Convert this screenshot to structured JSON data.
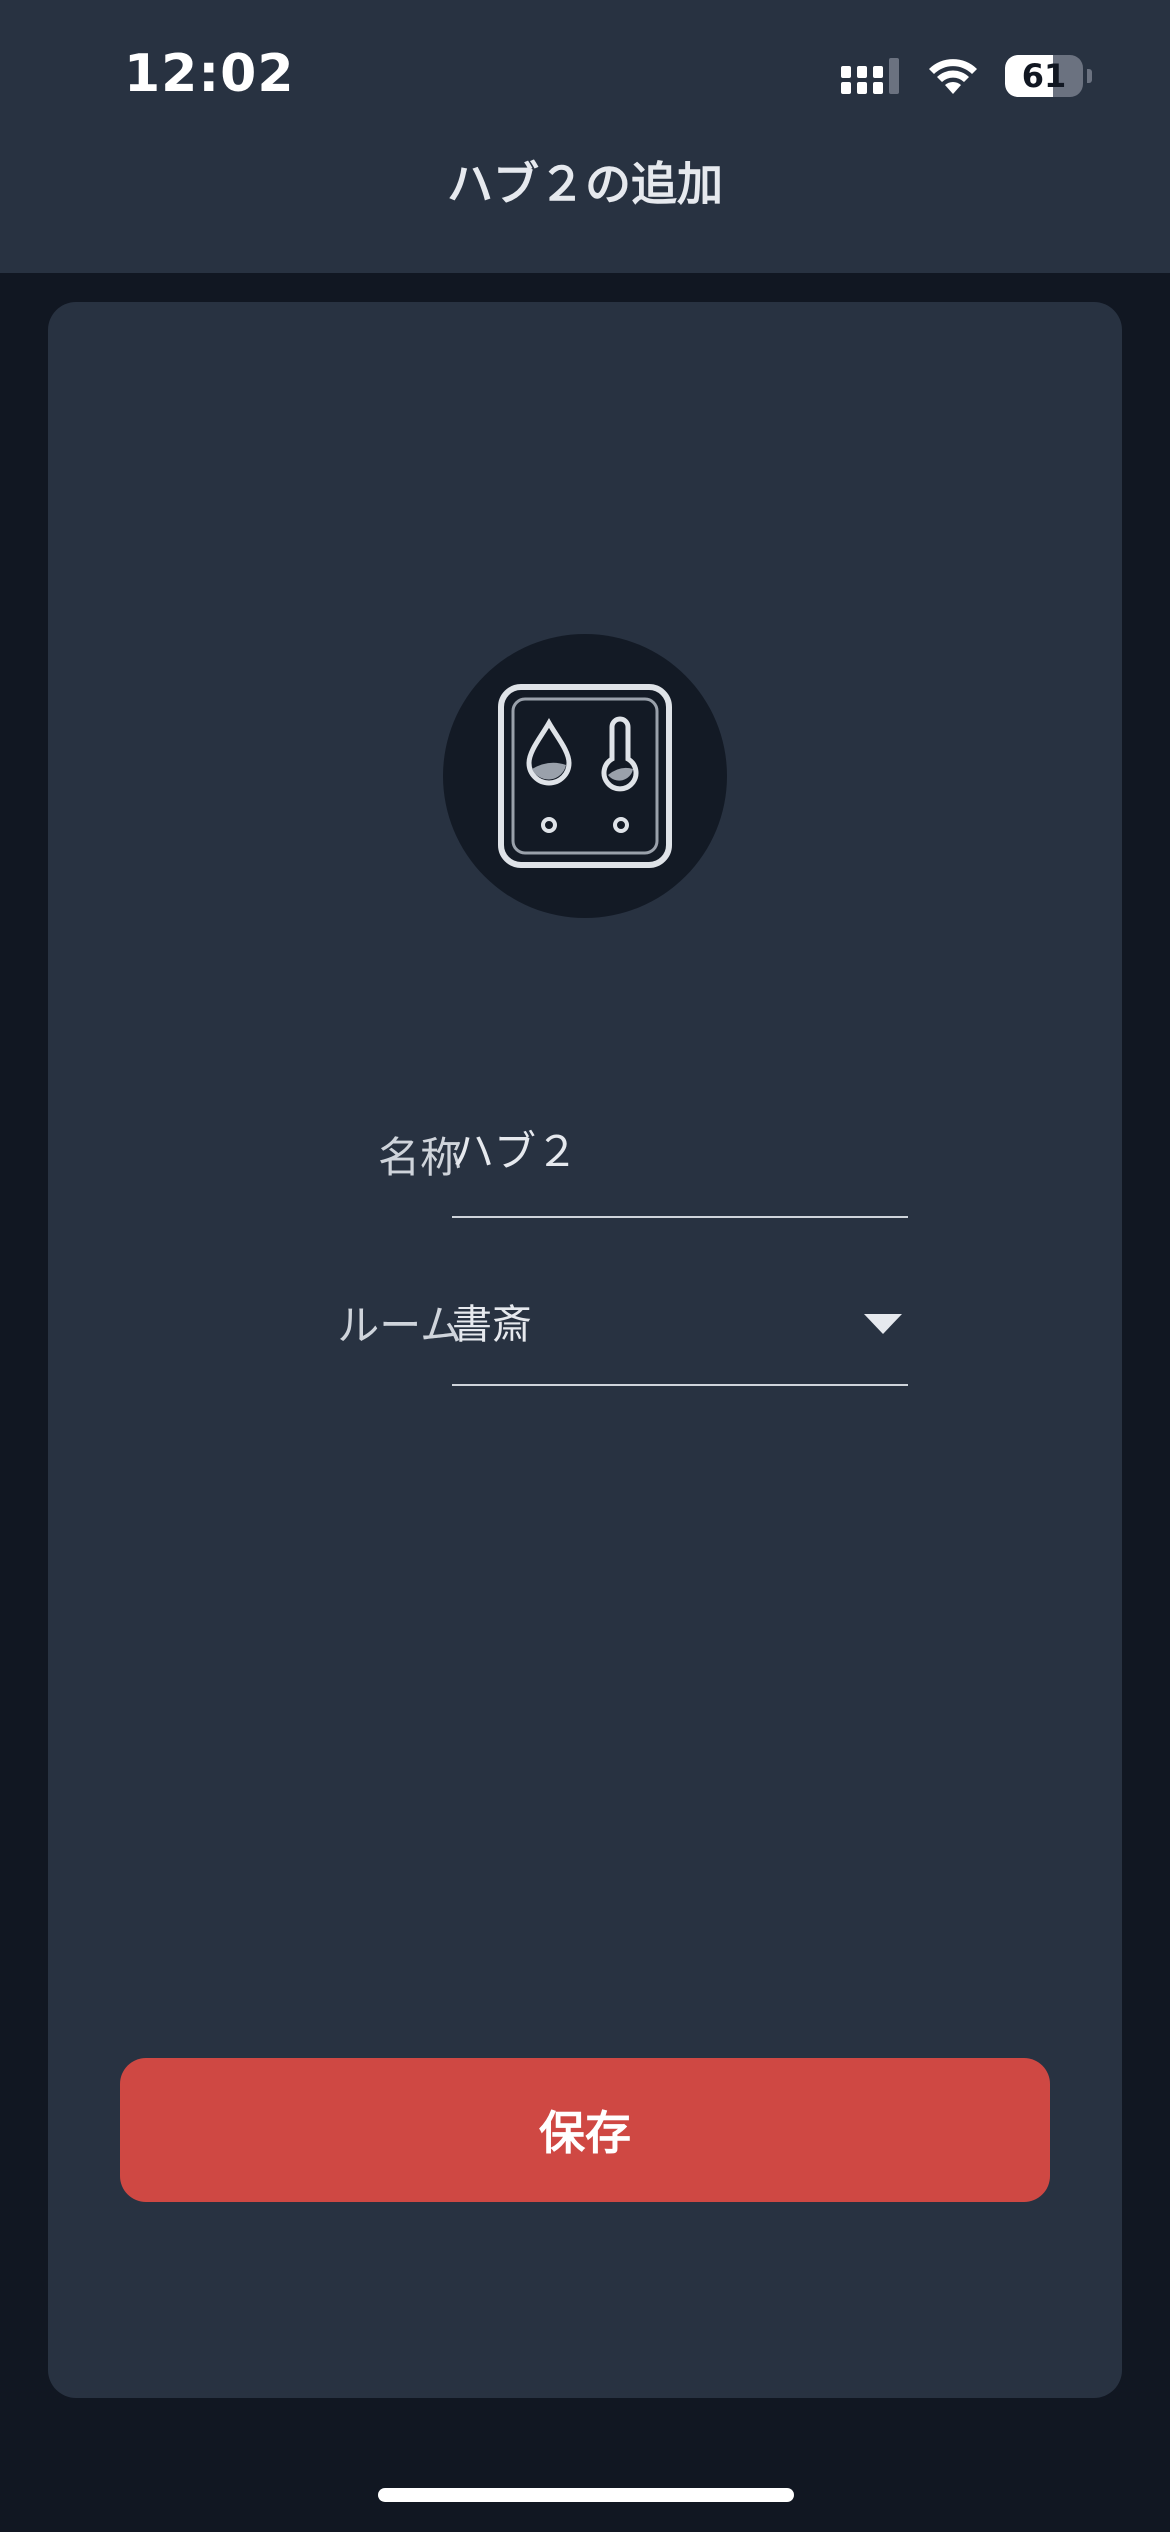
{
  "status_bar": {
    "time": "12:02",
    "battery_level": "61",
    "battery_fraction": 0.61,
    "icons": [
      "cellular-signal-icon",
      "wifi-icon",
      "battery-icon"
    ]
  },
  "header": {
    "title": "ハブ２の追加"
  },
  "device": {
    "icon": "hub-thermo-hygrometer-icon"
  },
  "form": {
    "name_label": "名称",
    "name_value": "ハブ２",
    "room_label": "ルーム",
    "room_value": "書斎"
  },
  "actions": {
    "save_label": "保存"
  },
  "colors": {
    "background": "#111722",
    "surface": "#283241",
    "icon_circle": "#131a25",
    "accent": "#cf4843",
    "text": "#e6e9ee"
  }
}
